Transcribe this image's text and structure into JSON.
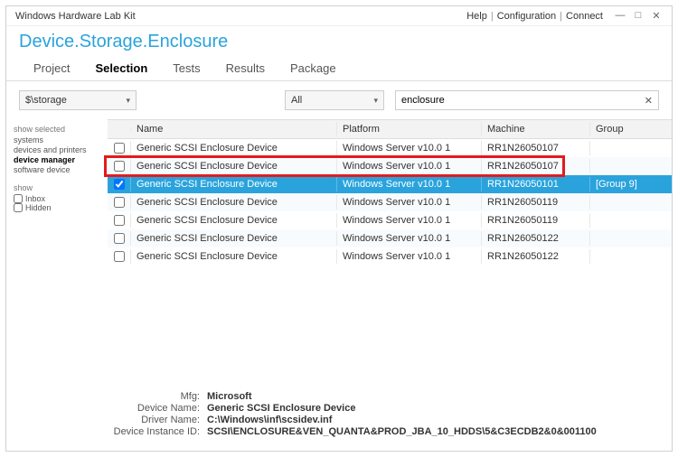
{
  "titlebar": {
    "title": "Windows Hardware Lab Kit",
    "links": [
      "Help",
      "Configuration",
      "Connect"
    ]
  },
  "page_title": "Device.Storage.Enclosure",
  "tabs": [
    "Project",
    "Selection",
    "Tests",
    "Results",
    "Package"
  ],
  "active_tab_index": 1,
  "filters": {
    "scope": "$\\storage",
    "category": "All",
    "search_value": "enclosure"
  },
  "sidebar": {
    "show_selected_title": "show selected",
    "opts": [
      "systems",
      "devices and printers",
      "device manager",
      "software device"
    ],
    "bold_index": 2,
    "show_title": "show",
    "checks": [
      {
        "label": "Inbox",
        "checked": false
      },
      {
        "label": "Hidden",
        "checked": false
      }
    ]
  },
  "columns": [
    "",
    "Name",
    "Platform",
    "Machine",
    "Group"
  ],
  "rows": [
    {
      "checked": false,
      "name": "Generic SCSI Enclosure Device",
      "platform": "Windows Server v10.0 1",
      "machine": "RR1N26050107",
      "group": ""
    },
    {
      "checked": false,
      "name": "Generic SCSI Enclosure Device",
      "platform": "Windows Server v10.0 1",
      "machine": "RR1N26050107",
      "group": ""
    },
    {
      "checked": true,
      "name": "Generic SCSI Enclosure Device",
      "platform": "Windows Server v10.0 1",
      "machine": "RR1N26050101",
      "group": "[Group 9]"
    },
    {
      "checked": false,
      "name": "Generic SCSI Enclosure Device",
      "platform": "Windows Server v10.0 1",
      "machine": "RR1N26050119",
      "group": ""
    },
    {
      "checked": false,
      "name": "Generic SCSI Enclosure Device",
      "platform": "Windows Server v10.0 1",
      "machine": "RR1N26050119",
      "group": ""
    },
    {
      "checked": false,
      "name": "Generic SCSI Enclosure Device",
      "platform": "Windows Server v10.0 1",
      "machine": "RR1N26050122",
      "group": ""
    },
    {
      "checked": false,
      "name": "Generic SCSI Enclosure Device",
      "platform": "Windows Server v10.0 1",
      "machine": "RR1N26050122",
      "group": ""
    }
  ],
  "selected_index": 2,
  "details": {
    "mfg_label": "Mfg:",
    "mfg": "Microsoft",
    "devname_label": "Device Name:",
    "devname": "Generic SCSI Enclosure Device",
    "driver_label": "Driver Name:",
    "driver": "C:\\Windows\\inf\\scsidev.inf",
    "instance_label": "Device Instance ID:",
    "instance": "SCSI\\ENCLOSURE&VEN_QUANTA&PROD_JBA_10_HDDS\\5&C3ECDB2&0&001100"
  }
}
